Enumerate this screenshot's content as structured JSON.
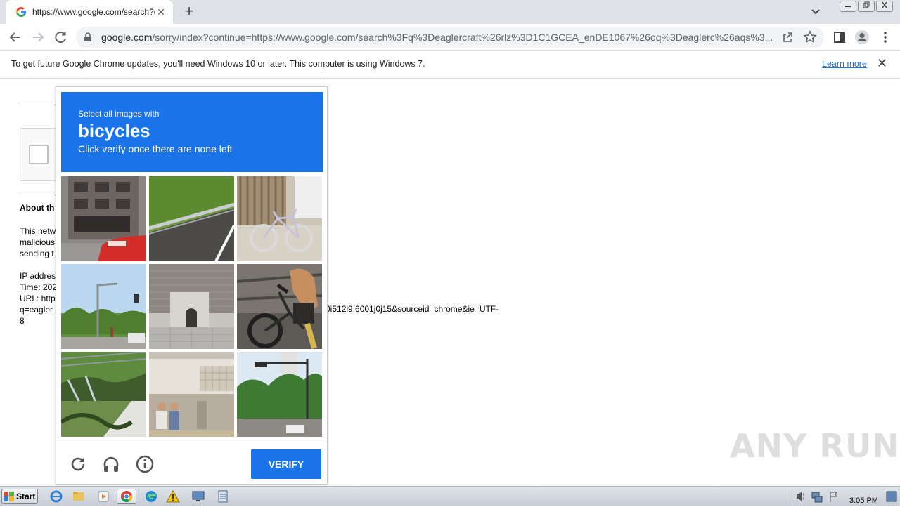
{
  "browser": {
    "tab_title": "https://www.google.com/search?q=",
    "tab_close": "✕",
    "new_tab": "+",
    "url_host": "google.com",
    "url_path": "/sorry/index?continue=https://www.google.com/search%3Fq%3Deaglercraft%26rlz%3D1C1GCEA_enDE1067%26oq%3Deaglerc%26aqs%3..."
  },
  "infobar": {
    "message": "To get future Google Chrome updates, you'll need Windows 10 or later. This computer is using Windows 7.",
    "learn_more": "Learn more",
    "close": "✕"
  },
  "page": {
    "about_heading": "About th",
    "para1": [
      "This netw",
      "malicious",
      "sending t"
    ],
    "info": [
      "IP addres",
      "Time: 202",
      "URL: http",
      "q=eagler",
      "8"
    ],
    "url_tail": "0i512l9.6001j0j15&sourceid=chrome&ie=UTF-"
  },
  "captcha": {
    "instruction": "Select all images with",
    "target": "bicycles",
    "hint": "Click verify once there are none left",
    "verify_label": "VERIFY",
    "tiles": [
      "building-with-red-car",
      "road-with-guardrail",
      "bicycle-by-fence",
      "street-with-traffic-light",
      "building-entrance",
      "person-on-bicycle",
      "balcony-with-plants",
      "church-sign-people",
      "street-with-traffic-light-2"
    ]
  },
  "watermark": "ANY RUN",
  "taskbar": {
    "start_label": "Start",
    "clock": "3:05 PM"
  },
  "colors": {
    "accent": "#1a73e8",
    "tabstrip": "#dee1e6"
  }
}
